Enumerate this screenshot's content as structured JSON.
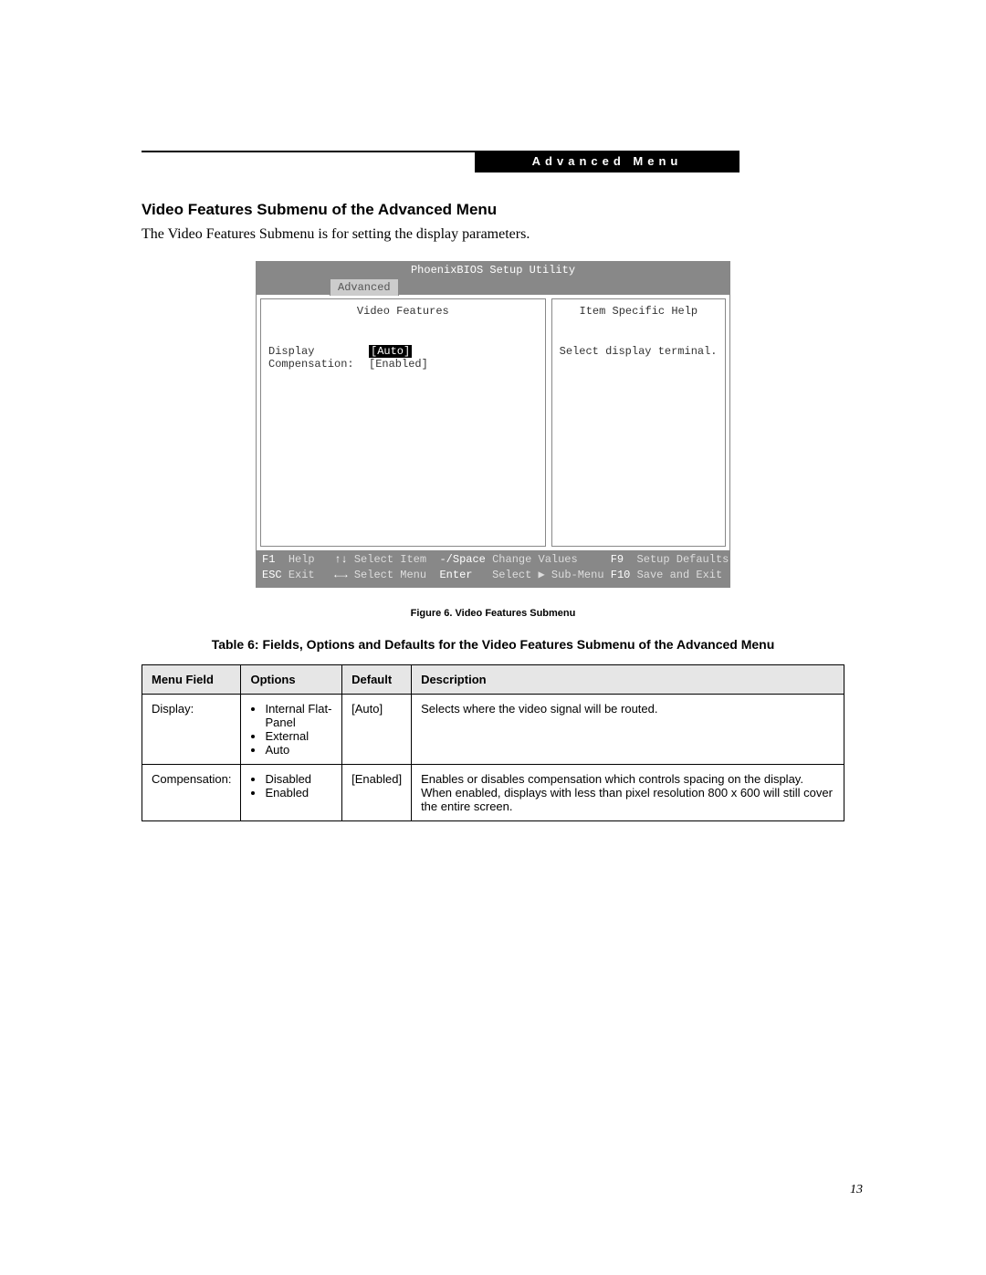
{
  "header_badge": "Advanced Menu",
  "section_title": "Video Features Submenu of the Advanced Menu",
  "section_intro": "The Video Features Submenu is for setting the display parameters.",
  "bios": {
    "title": "PhoenixBIOS Setup Utility",
    "tab": "Advanced",
    "left_title": "Video Features",
    "right_title": "Item Specific Help",
    "right_text": "Select display terminal.",
    "rows": [
      {
        "label": "Display",
        "value": "[Auto]",
        "selected": true
      },
      {
        "label": "Compensation:",
        "value": "[Enabled]",
        "selected": false
      }
    ],
    "footer": {
      "line1": {
        "k1": "F1",
        "t1": "Help",
        "k2": "↑↓",
        "t2": "Select Item",
        "k3": "-/Space",
        "t3": "Change Values",
        "k4": "F9",
        "t4": "Setup Defaults"
      },
      "line2": {
        "k1": "ESC",
        "t1": "Exit",
        "k2": "←→",
        "t2": "Select Menu",
        "k3": "Enter",
        "t3": "Select ▶ Sub-Menu",
        "k4": "F10",
        "t4": "Save and Exit"
      }
    }
  },
  "figure_caption": "Figure 6.  Video Features Submenu",
  "table_caption": "Table 6: Fields, Options and Defaults for the Video Features Submenu of the Advanced Menu",
  "table": {
    "headers": [
      "Menu Field",
      "Options",
      "Default",
      "Description"
    ],
    "rows": [
      {
        "field": "Display:",
        "options": [
          "Internal Flat-Panel",
          "External",
          "Auto"
        ],
        "default": "[Auto]",
        "description": "Selects where the video signal will be routed."
      },
      {
        "field": "Compensation:",
        "options": [
          "Disabled",
          "Enabled"
        ],
        "default": "[Enabled]",
        "description": "Enables or disables compensation which controls spacing on the display. When enabled, displays with less than pixel resolution 800 x 600 will still cover the entire screen."
      }
    ]
  },
  "page_number": "13"
}
